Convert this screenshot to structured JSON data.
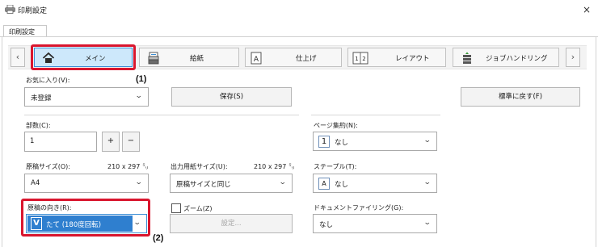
{
  "window": {
    "title": "印刷設定",
    "close_glyph": "×"
  },
  "tab": {
    "label": "印刷設定"
  },
  "ribbon": {
    "prev": "‹",
    "next": "›",
    "items": [
      {
        "label": "メイン",
        "icon": "home-icon"
      },
      {
        "label": "給紙",
        "icon": "paper-tray-icon"
      },
      {
        "label": "仕上げ",
        "icon": "finishing-icon"
      },
      {
        "label": "レイアウト",
        "icon": "layout-icon"
      },
      {
        "label": "ジョブハンドリング",
        "icon": "job-handling-icon"
      }
    ]
  },
  "callouts": {
    "one": "(1)",
    "two": "(2)"
  },
  "favorites": {
    "label": "お気に入り(V):",
    "value": "未登録",
    "save": "保存(S)",
    "reset": "標準に戻す(F)"
  },
  "copies": {
    "label": "部数(C):",
    "value": "1",
    "plus": "+",
    "minus": "−"
  },
  "original_size": {
    "label": "原稿サイズ(O):",
    "dims": "210 x 297 ㍉",
    "value": "A4"
  },
  "output_size": {
    "label": "出力用紙サイズ(U):",
    "dims": "210 x 297 ㍉",
    "value": "原稿サイズと同じ"
  },
  "orientation": {
    "label": "原稿の向き(R):",
    "value": "たて (180度回転)",
    "icon_glyph": "V"
  },
  "zoom": {
    "label": "ズーム(Z)",
    "checked": false,
    "settings": "設定..."
  },
  "n_up": {
    "label": "ページ集約(N):",
    "icon_glyph": "1",
    "value": "なし"
  },
  "staple": {
    "label": "ステープル(T):",
    "icon_glyph": "A",
    "value": "なし"
  },
  "filing": {
    "label": "ドキュメントファイリング(G):",
    "value": "なし"
  },
  "colors": {
    "highlight": "#d9162e",
    "selected": "#3c8fd6",
    "selected_bg": "#cde8fb"
  }
}
